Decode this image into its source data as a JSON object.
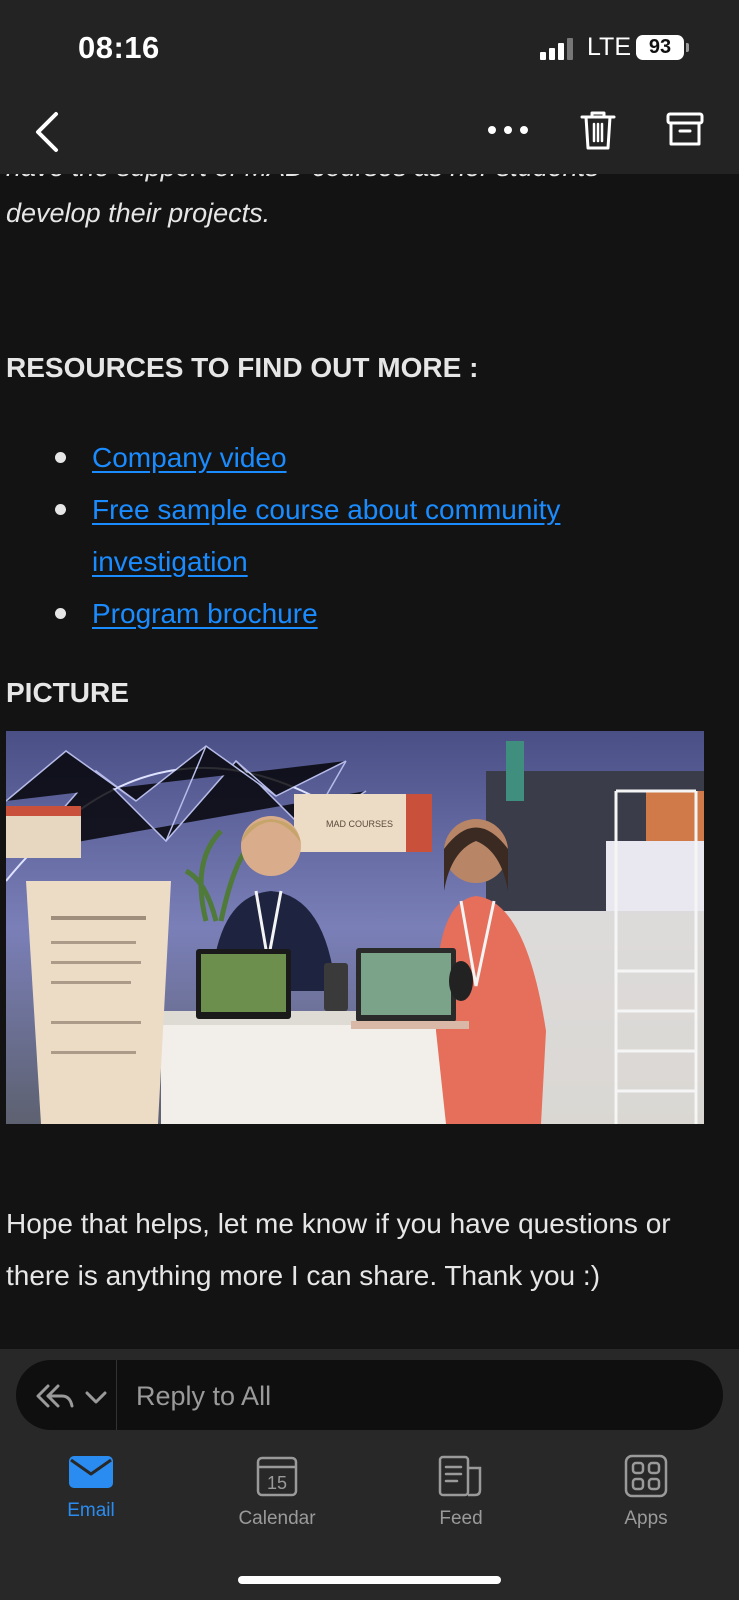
{
  "status_bar": {
    "time": "08:16",
    "network": "LTE",
    "battery": "93"
  },
  "header": {
    "icons": [
      "chevron-left-icon",
      "more-icon",
      "trash-icon",
      "archive-icon"
    ]
  },
  "email": {
    "partial_top_line": "have the support of MAD courses as her students",
    "italic_line": "develop their projects.",
    "resources_heading": "RESOURCES TO FIND OUT MORE :",
    "links": [
      {
        "label": "Company video "
      },
      {
        "label": "Free sample course about community investigation"
      },
      {
        "label": "Program brochure "
      }
    ],
    "picture_heading": "PICTURE",
    "photo_sign": "MAD COURSES",
    "closing_line_1": "Hope that helps, let me know if you have questions or",
    "closing_line_2": "there is anything more I can share. Thank you :)"
  },
  "reply": {
    "placeholder": "Reply to All"
  },
  "tabs": [
    {
      "label": "Email",
      "active": true
    },
    {
      "label": "Calendar",
      "calendar_day": "15"
    },
    {
      "label": "Feed"
    },
    {
      "label": "Apps"
    }
  ],
  "colors": {
    "accent": "#2a8cf0",
    "link": "#1a8cff",
    "background": "#131313",
    "header": "#232323"
  }
}
